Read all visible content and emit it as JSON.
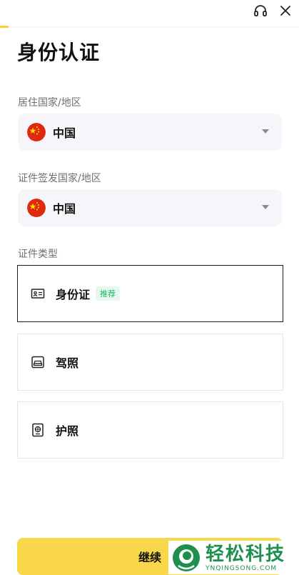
{
  "page": {
    "title": "身份认证"
  },
  "residence": {
    "label": "居住国家/地区",
    "value": "中国",
    "flag": "china-flag-icon"
  },
  "issuing": {
    "label": "证件签发国家/地区",
    "value": "中国",
    "flag": "china-flag-icon"
  },
  "doc_type": {
    "label": "证件类型",
    "options": [
      {
        "label": "身份证",
        "badge": "推荐",
        "icon": "id-card-icon",
        "selected": true
      },
      {
        "label": "驾照",
        "icon": "driver-license-icon",
        "selected": false
      },
      {
        "label": "护照",
        "icon": "passport-icon",
        "selected": false
      }
    ]
  },
  "continue_label": "继续",
  "watermark": {
    "cn": "轻松科技",
    "en": "YNQINGSONG.COM"
  },
  "colors": {
    "accent": "#F8D748",
    "badge_green": "#1db36a",
    "select_bg": "#F6F5F9"
  },
  "icons": {
    "support": "headset-icon",
    "close": "close-icon",
    "caret": "caret-down-icon"
  }
}
